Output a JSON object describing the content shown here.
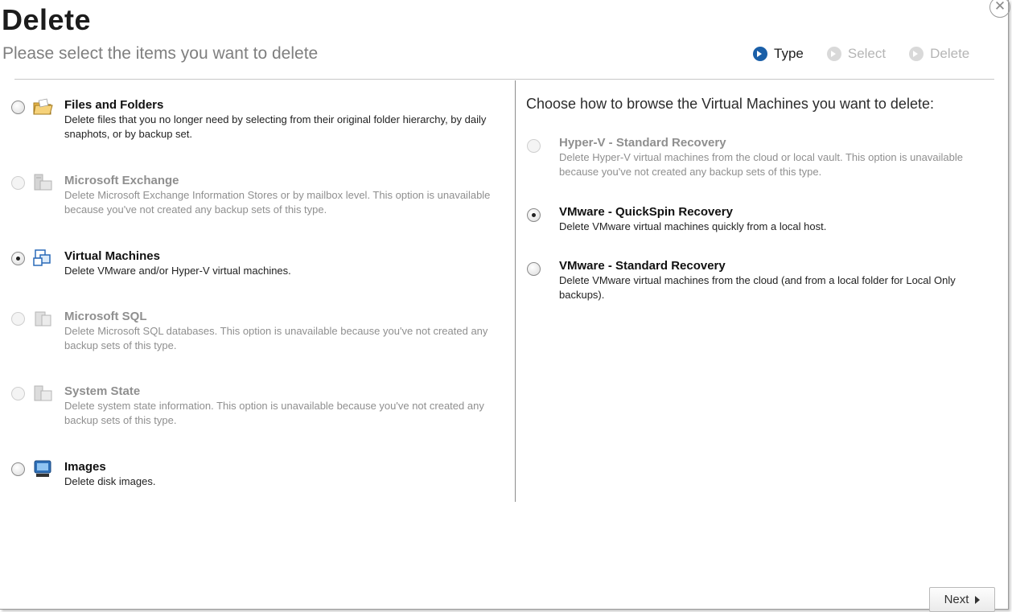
{
  "dialog": {
    "title": "Delete",
    "subtitle": "Please select the items you want to delete",
    "close_glyph": "✕"
  },
  "steps": [
    {
      "label": "Type",
      "state": "active"
    },
    {
      "label": "Select",
      "state": "inactive"
    },
    {
      "label": "Delete",
      "state": "inactive"
    }
  ],
  "left_options": [
    {
      "title": "Files and Folders",
      "description": "Delete files that you no longer need by selecting from their original folder hierarchy, by daily snaphots, or by backup set.",
      "icon": "folder-icon",
      "enabled": true,
      "selected": false
    },
    {
      "title": "Microsoft Exchange",
      "description": "Delete Microsoft Exchange Information Stores or by mailbox level. This option is unavailable because you've not created any backup sets of this type.",
      "icon": "exchange-icon",
      "enabled": false,
      "selected": false
    },
    {
      "title": "Virtual Machines",
      "description": "Delete VMware and/or Hyper-V virtual machines.",
      "icon": "virtual-machines-icon",
      "enabled": true,
      "selected": true
    },
    {
      "title": "Microsoft SQL",
      "description": "Delete Microsoft SQL databases. This option is unavailable because you've not created any backup sets of this type.",
      "icon": "sql-icon",
      "enabled": false,
      "selected": false
    },
    {
      "title": "System State",
      "description": "Delete system state information. This option is unavailable because you've not created any backup sets of this type.",
      "icon": "system-state-icon",
      "enabled": false,
      "selected": false
    },
    {
      "title": "Images",
      "description": "Delete disk images.",
      "icon": "disk-image-icon",
      "enabled": true,
      "selected": false
    }
  ],
  "right_panel": {
    "heading": "Choose how to browse the Virtual Machines you want to delete:",
    "options": [
      {
        "title": "Hyper-V - Standard Recovery",
        "description": "Delete Hyper-V virtual machines from the cloud or local vault. This option is unavailable because you've not created any backup sets of this type.",
        "enabled": false,
        "selected": false
      },
      {
        "title": "VMware - QuickSpin Recovery",
        "description": "Delete VMware virtual machines quickly from a local host.",
        "enabled": true,
        "selected": true
      },
      {
        "title": "VMware - Standard Recovery",
        "description": "Delete VMware virtual machines from the cloud (and from a local folder for Local Only backups).",
        "enabled": true,
        "selected": false
      }
    ]
  },
  "footer": {
    "next_label": "Next"
  },
  "colors": {
    "accent": "#1a5fa8",
    "disabled_text": "#8f8f8f",
    "divider": "#c7c7c7"
  }
}
